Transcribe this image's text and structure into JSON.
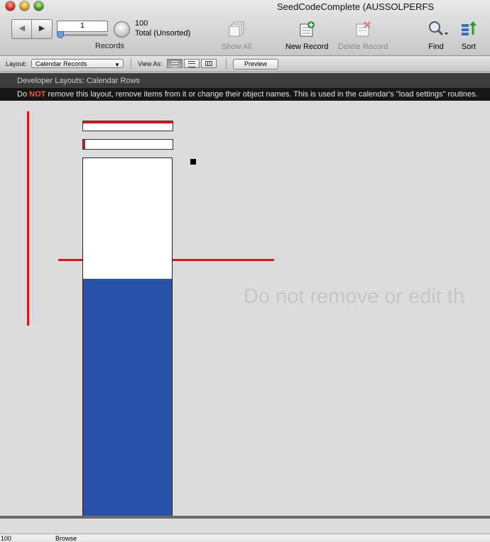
{
  "window": {
    "title": "SeedCodeComplete (AUSSOLPERFS"
  },
  "toolbar": {
    "record_number": "1",
    "records_label": "Records",
    "record_count": "100",
    "record_status": "Total (Unsorted)",
    "show_all_label": "Show All",
    "new_record_label": "New Record",
    "delete_record_label": "Delete Record",
    "find_label": "Find",
    "sort_label": "Sort"
  },
  "layoutbar": {
    "layout_label": "Layout:",
    "layout_value": "Calendar Records",
    "view_as_label": "View As:",
    "preview_label": "Preview"
  },
  "header": {
    "title": "Developer Layouts: Calendar Rows",
    "warning_prefix": "Do ",
    "warning_not": "NOT",
    "warning_rest": " remove this layout, remove items from it or change their object names. This is used in the calendar's \"load settings\" routines."
  },
  "canvas": {
    "ghost_text": "Do not remove or edit th"
  },
  "statusbar": {
    "zoom": "100",
    "mode": "Browse"
  },
  "colors": {
    "accent_red": "#e0121a",
    "fill_blue": "#2b52aa",
    "warning_orange": "#f05a1e"
  }
}
